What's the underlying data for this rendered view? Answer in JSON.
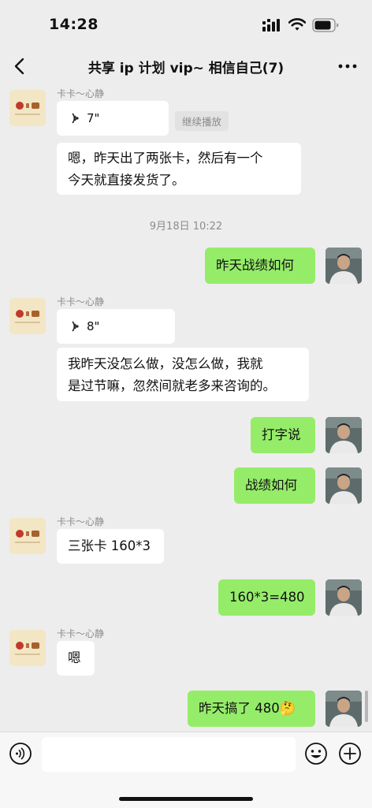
{
  "status_bar": {
    "time": "14:28"
  },
  "nav": {
    "title": "共享 ip 计划 vip~ 相信自己(7)"
  },
  "messages": [
    {
      "sender": "卡卡～心静",
      "duration": "7\"",
      "chip": "继续播放"
    },
    {
      "line1": "嗯，昨天出了两张卡，然后有一个",
      "line2": "今天就直接发货了。"
    },
    {
      "timestamp": "9月18日 10:22"
    },
    {
      "text": "昨天战绩如何"
    },
    {
      "sender": "卡卡～心静",
      "duration": "8\""
    },
    {
      "line1": "我昨天没怎么做，没怎么做，我就",
      "line2": "是过节嘛，忽然间就老多来咨询的。"
    },
    {
      "text": "打字说"
    },
    {
      "text": "战绩如何"
    },
    {
      "sender": "卡卡～心静",
      "text": "三张卡 160*3"
    },
    {
      "text": "160*3=480"
    },
    {
      "sender": "卡卡～心静",
      "text": "嗯"
    },
    {
      "text": "昨天搞了 480",
      "emoji": "🤔"
    }
  ],
  "colors": {
    "outgoing_bubble": "#95ec69",
    "incoming_bubble": "#ffffff",
    "background": "#ededed"
  },
  "icons": [
    "back-arrow-icon",
    "more-icon",
    "voice-icon",
    "emoji-icon",
    "plus-icon"
  ]
}
